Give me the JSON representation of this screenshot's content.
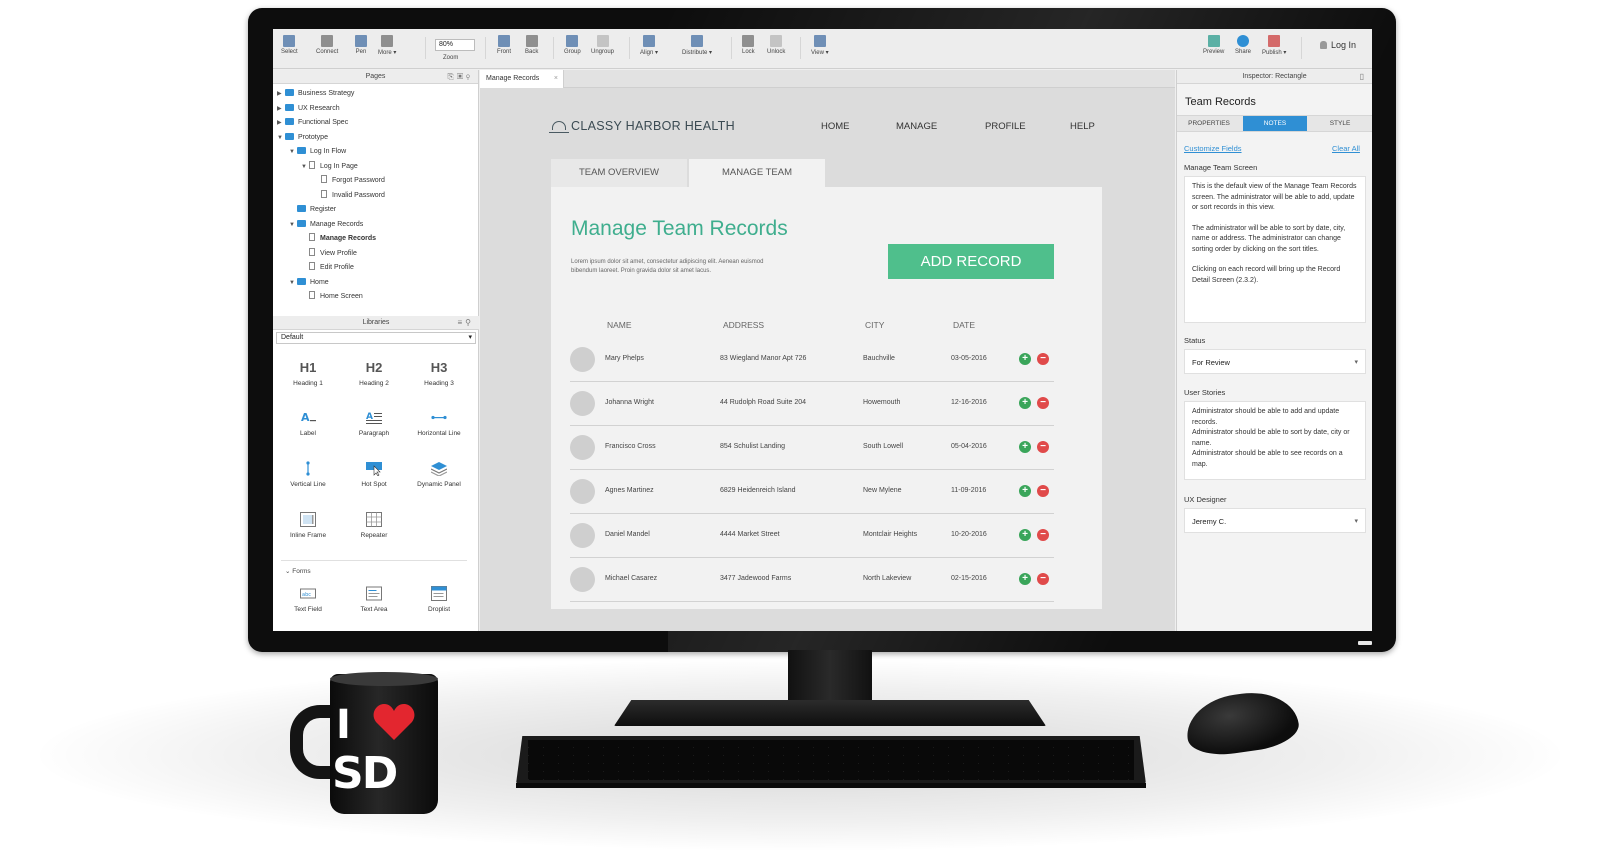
{
  "toolbar": {
    "tools": [
      {
        "label": "Select",
        "icon": "select-icon"
      },
      {
        "label": "Connect",
        "icon": "connect-icon"
      },
      {
        "label": "Pen",
        "icon": "pen-icon"
      },
      {
        "label": "More ▾",
        "icon": "more-icon"
      },
      {
        "label": "Front",
        "icon": "bring-front-icon"
      },
      {
        "label": "Back",
        "icon": "send-back-icon"
      },
      {
        "label": "Group",
        "icon": "group-icon"
      },
      {
        "label": "Ungroup",
        "icon": "ungroup-icon"
      },
      {
        "label": "Align ▾",
        "icon": "align-icon"
      },
      {
        "label": "Distribute ▾",
        "icon": "distribute-icon"
      },
      {
        "label": "Lock",
        "icon": "lock-icon"
      },
      {
        "label": "Unlock",
        "icon": "unlock-icon"
      },
      {
        "label": "View ▾",
        "icon": "view-icon"
      },
      {
        "label": "Preview",
        "icon": "preview-icon"
      },
      {
        "label": "Share",
        "icon": "share-icon"
      },
      {
        "label": "Publish ▾",
        "icon": "publish-icon"
      }
    ],
    "zoom_value": "80%",
    "zoom_label": "Zoom",
    "login_label": "Log In"
  },
  "pages_panel": {
    "title": "Pages",
    "items": [
      {
        "label": "Business Strategy",
        "level": 0,
        "type": "folder",
        "twisty": "▶"
      },
      {
        "label": "UX Research",
        "level": 0,
        "type": "folder",
        "twisty": "▶"
      },
      {
        "label": "Functional Spec",
        "level": 0,
        "type": "folder",
        "twisty": "▶"
      },
      {
        "label": "Prototype",
        "level": 0,
        "type": "folder",
        "twisty": "▼"
      },
      {
        "label": "Log In Flow",
        "level": 1,
        "type": "folder",
        "twisty": "▼"
      },
      {
        "label": "Log In Page",
        "level": 2,
        "type": "page",
        "twisty": "▼"
      },
      {
        "label": "Forgot Password",
        "level": 3,
        "type": "page",
        "twisty": ""
      },
      {
        "label": "Invalid Password",
        "level": 3,
        "type": "page",
        "twisty": ""
      },
      {
        "label": "Register",
        "level": 1,
        "type": "folder",
        "twisty": ""
      },
      {
        "label": "Manage Records",
        "level": 1,
        "type": "folder",
        "twisty": "▼"
      },
      {
        "label": "Manage Records",
        "level": 2,
        "type": "page",
        "twisty": "",
        "bold": true
      },
      {
        "label": "View Profile",
        "level": 2,
        "type": "page",
        "twisty": ""
      },
      {
        "label": "Edit Profile",
        "level": 2,
        "type": "page",
        "twisty": ""
      },
      {
        "label": "Home",
        "level": 1,
        "type": "folder",
        "twisty": "▼"
      },
      {
        "label": "Home Screen",
        "level": 2,
        "type": "page",
        "twisty": ""
      }
    ]
  },
  "libraries_panel": {
    "title": "Libraries",
    "selected": "Default",
    "widgets": [
      {
        "glyph": "H1",
        "label": "Heading 1"
      },
      {
        "glyph": "H2",
        "label": "Heading 2"
      },
      {
        "glyph": "H3",
        "label": "Heading 3"
      },
      {
        "glyph": "",
        "label": "Label",
        "icon": "label-icon"
      },
      {
        "glyph": "",
        "label": "Paragraph",
        "icon": "paragraph-icon"
      },
      {
        "glyph": "",
        "label": "Horizontal Line",
        "icon": "horizontal-line-icon"
      },
      {
        "glyph": "",
        "label": "Vertical Line",
        "icon": "vertical-line-icon"
      },
      {
        "glyph": "",
        "label": "Hot Spot",
        "icon": "hot-spot-icon"
      },
      {
        "glyph": "",
        "label": "Dynamic Panel",
        "icon": "dynamic-panel-icon"
      },
      {
        "glyph": "",
        "label": "Inline Frame",
        "icon": "inline-frame-icon"
      },
      {
        "glyph": "",
        "label": "Repeater",
        "icon": "repeater-icon"
      }
    ],
    "forms_label": "Forms",
    "form_widgets": [
      {
        "label": "Text Field",
        "icon": "text-field-icon"
      },
      {
        "label": "Text Area",
        "icon": "text-area-icon"
      },
      {
        "label": "Droplist",
        "icon": "droplist-icon"
      }
    ]
  },
  "document_tab": {
    "label": "Manage Records",
    "close": "×"
  },
  "prototype": {
    "brand": "CLASSY HARBOR HEALTH",
    "nav": [
      "HOME",
      "MANAGE",
      "PROFILE",
      "HELP"
    ],
    "tabs": [
      "TEAM OVERVIEW",
      "MANAGE TEAM"
    ],
    "title": "Manage Team Records",
    "description": "Lorem ipsum dolor sit amet, consectetur adipiscing elit. Aenean euismod bibendum laoreet. Proin gravida dolor sit amet lacus.",
    "add_button": "ADD RECORD",
    "columns": [
      "NAME",
      "ADDRESS",
      "CITY",
      "DATE"
    ],
    "rows": [
      {
        "name": "Mary Phelps",
        "address": "83 Wiegland Manor Apt 726",
        "city": "Bauchville",
        "date": "03-05-2016"
      },
      {
        "name": "Johanna Wright",
        "address": "44 Rudolph Road Suite 204",
        "city": "Howemouth",
        "date": "12-16-2016"
      },
      {
        "name": "Francisco Cross",
        "address": "854 Schulist Landing",
        "city": "South Lowell",
        "date": "05-04-2016"
      },
      {
        "name": "Agnes Martinez",
        "address": "6829 Heidenreich Island",
        "city": "New Mylene",
        "date": "11-09-2016"
      },
      {
        "name": "Daniel Mandel",
        "address": "4444 Market Street",
        "city": "Montclair Heights",
        "date": "10-20-2016"
      },
      {
        "name": "Michael Casarez",
        "address": "3477 Jadewood Farms",
        "city": "North Lakeview",
        "date": "02-15-2016"
      }
    ]
  },
  "inspector": {
    "header": "Inspector: Rectangle",
    "title": "Team Records",
    "tabs": [
      "PROPERTIES",
      "NOTES",
      "STYLE"
    ],
    "active_tab": "NOTES",
    "customize_fields": "Customize Fields",
    "clear_all": "Clear All",
    "section_label": "Manage Team Screen",
    "notes": [
      "This is the default view of the Manage Team Records screen. The administrator will be able to add, update or sort records in this view.",
      "The administrator will be able to sort by date, city, name or address. The administrator can change sorting order by clicking on the sort titles.",
      "Clicking on each record will bring up the Record Detail Screen (2.3.2)."
    ],
    "status_label": "Status",
    "status_value": "For Review",
    "user_stories_label": "User Stories",
    "user_stories": [
      "Administrator should be able to add and update records.",
      "Administrator should be able to sort by date, city or name.",
      "Administrator should be able to see records on a map."
    ],
    "ux_designer_label": "UX Designer",
    "ux_designer_value": "Jeremy C."
  },
  "mug": {
    "letter_i": "I",
    "letters_sd": "SD"
  },
  "colors": {
    "accent_blue": "#2f8fd4",
    "accent_green": "#4fbf8c",
    "title_green": "#3fae8e",
    "add_icon": "#3aa55a",
    "remove_icon": "#e04a4a"
  }
}
